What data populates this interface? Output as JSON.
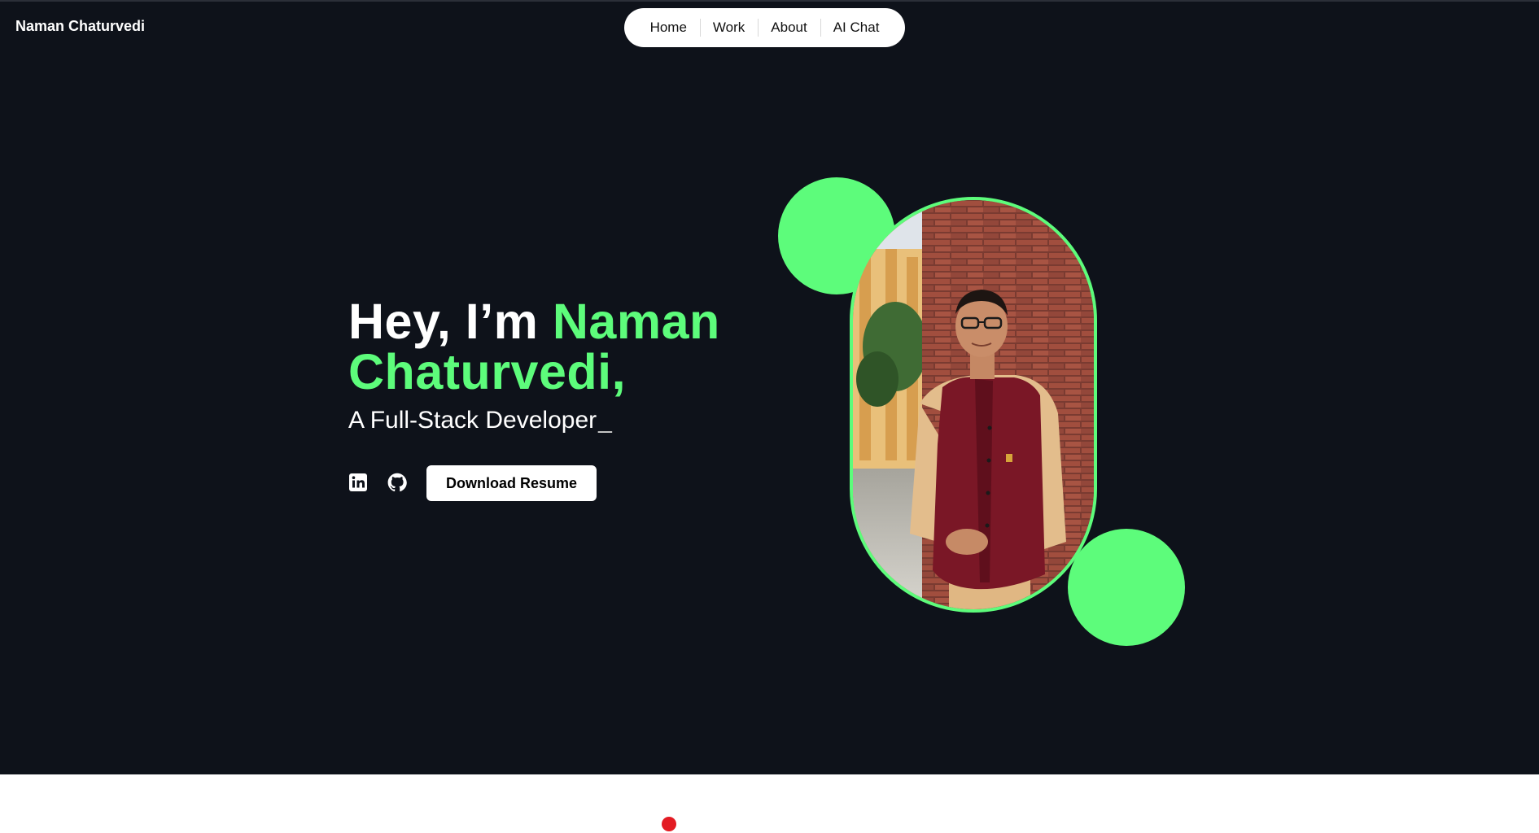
{
  "header": {
    "brand": "Naman Chaturvedi",
    "nav": [
      {
        "label": "Home"
      },
      {
        "label": "Work"
      },
      {
        "label": "About"
      },
      {
        "label": "AI Chat"
      }
    ]
  },
  "hero": {
    "greeting": "Hey, I’m ",
    "name_line1": "Naman",
    "name_line2": "Chaturvedi,",
    "subtitle": "A Full-Stack Developer",
    "cursor": "_",
    "resume_button": "Download Resume",
    "social": [
      {
        "icon": "linkedin-icon"
      },
      {
        "icon": "github-icon"
      }
    ]
  },
  "colors": {
    "background": "#0e121a",
    "accent": "#5dfc7b",
    "dot": "#e31b23"
  }
}
